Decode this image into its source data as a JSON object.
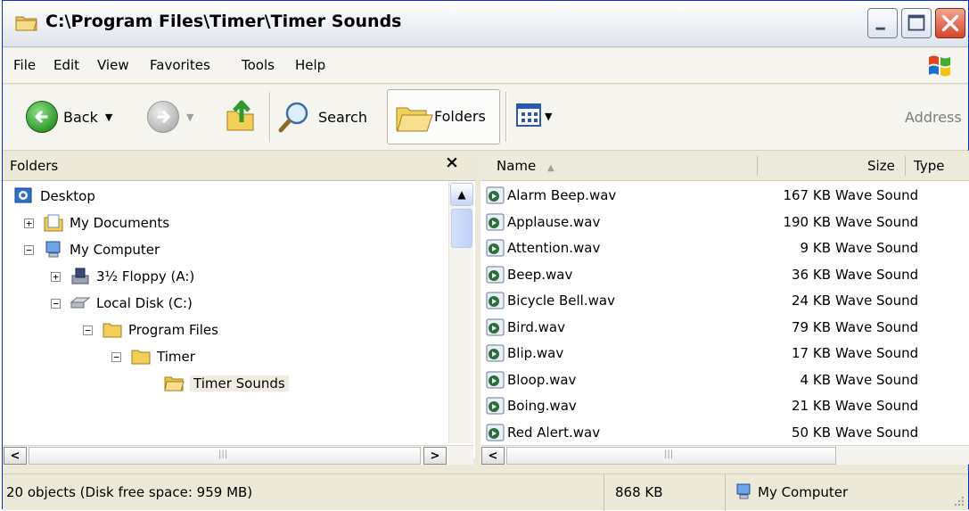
{
  "window": {
    "title": "C:\\Program Files\\Timer\\Timer Sounds"
  },
  "menu": [
    "File",
    "Edit",
    "View",
    "Favorites",
    "Tools",
    "Help"
  ],
  "toolbar": {
    "back_label": "Back",
    "search_label": "Search",
    "folders_label": "Folders",
    "address_label": "Address"
  },
  "folders_pane": {
    "title": "Folders",
    "close_glyph": "×",
    "tree": [
      {
        "label": "Desktop",
        "icon": "desktop-icon"
      },
      {
        "label": "My Documents",
        "icon": "my-documents-icon",
        "toggle": "+"
      },
      {
        "label": "My Computer",
        "icon": "my-computer-icon",
        "toggle": "−"
      },
      {
        "label": "3½ Floppy (A:)",
        "icon": "floppy-drive-icon",
        "toggle": "+"
      },
      {
        "label": "Local Disk (C:)",
        "icon": "hard-disk-icon",
        "toggle": "−"
      },
      {
        "label": "Program Files",
        "icon": "folder-icon",
        "toggle": "−"
      },
      {
        "label": "Timer",
        "icon": "folder-icon",
        "toggle": "−"
      },
      {
        "label": "Timer Sounds",
        "icon": "open-folder-icon",
        "selected": true
      }
    ]
  },
  "file_list": {
    "columns": {
      "name": "Name",
      "sort_glyph": "▲",
      "size": "Size",
      "type": "Type"
    },
    "rows": [
      {
        "name": "Alarm Beep.wav",
        "size": "167 KB",
        "type": "Wave Sound"
      },
      {
        "name": "Applause.wav",
        "size": "190 KB",
        "type": "Wave Sound"
      },
      {
        "name": "Attention.wav",
        "size": "9 KB",
        "type": "Wave Sound"
      },
      {
        "name": "Beep.wav",
        "size": "36 KB",
        "type": "Wave Sound"
      },
      {
        "name": "Bicycle Bell.wav",
        "size": "24 KB",
        "type": "Wave Sound"
      },
      {
        "name": "Bird.wav",
        "size": "79 KB",
        "type": "Wave Sound"
      },
      {
        "name": "Blip.wav",
        "size": "17 KB",
        "type": "Wave Sound"
      },
      {
        "name": "Bloop.wav",
        "size": "4 KB",
        "type": "Wave Sound"
      },
      {
        "name": "Boing.wav",
        "size": "21 KB",
        "type": "Wave Sound"
      },
      {
        "name": "Red Alert.wav",
        "size": "50 KB",
        "type": "Wave Sound"
      }
    ]
  },
  "status_bar": {
    "objects": "20 objects (Disk free space: 959 MB)",
    "size": "868 KB",
    "zone": "My Computer"
  },
  "colors": {
    "titlebar": "#dfe4ec",
    "window_frame": "#ece9d8",
    "close_button": "#d4462a",
    "selection": "#f0ede0"
  }
}
